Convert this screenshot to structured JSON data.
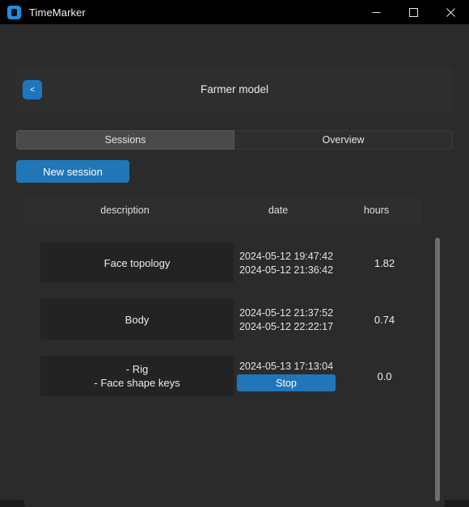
{
  "window": {
    "app_title": "TimeMarker",
    "app_icon": "timemarker-logo-icon",
    "controls": {
      "minimize": "minimize-icon",
      "maximize": "maximize-icon",
      "close": "close-icon"
    }
  },
  "header": {
    "back_label": "<",
    "title": "Farmer model"
  },
  "tabs": [
    {
      "label": "Sessions",
      "active": true
    },
    {
      "label": "Overview",
      "active": false
    }
  ],
  "toolbar": {
    "new_session_label": "New session"
  },
  "table": {
    "columns": [
      "description",
      "date",
      "hours"
    ],
    "rows": [
      {
        "description": "Face topology",
        "start": "2024-05-12 19:47:42",
        "end": "2024-05-12 21:36:42",
        "hours": "1.82",
        "running": false
      },
      {
        "description": "Body",
        "start": "2024-05-12 21:37:52",
        "end": "2024-05-12 22:22:17",
        "hours": "0.74",
        "running": false
      },
      {
        "description": "- Rig\n- Face shape keys",
        "start": "2024-05-13 17:13:04",
        "end": "",
        "stop_label": "Stop",
        "hours": "0.0",
        "running": true
      }
    ]
  },
  "colors": {
    "accent": "#2176b8",
    "titlebar": "#000000",
    "window_bg": "#2b2b2b",
    "panel_bg": "#2e2e2e",
    "row_bg": "#232323",
    "tab_active": "#4a4a4a",
    "scrollbar": "#6e6e6e"
  }
}
